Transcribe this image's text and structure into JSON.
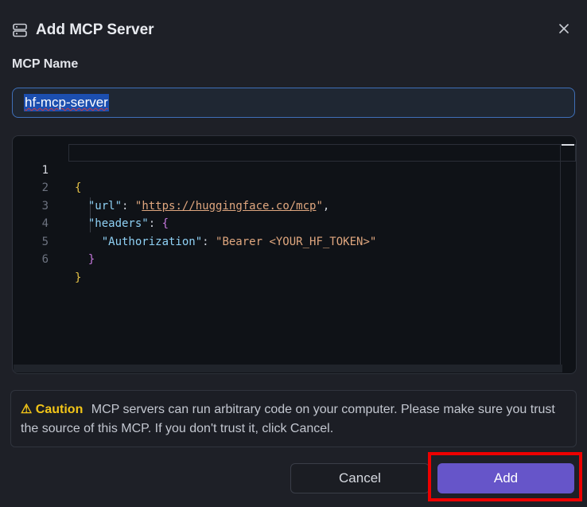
{
  "dialog": {
    "title": "Add MCP Server",
    "icon": "server-icon",
    "close_icon": "close-icon"
  },
  "name_field": {
    "label": "MCP Name",
    "value": "hf-mcp-server"
  },
  "editor": {
    "lines": [
      {
        "num": "1"
      },
      {
        "num": "2"
      },
      {
        "num": "3"
      },
      {
        "num": "4"
      },
      {
        "num": "5"
      },
      {
        "num": "6"
      }
    ],
    "tokens": {
      "open_brace": "{",
      "url_key": "\"url\"",
      "colon_space": ": ",
      "url_quote_open": "\"",
      "url_value": "https://huggingface.co/mcp",
      "url_quote_close": "\"",
      "comma": ",",
      "headers_key": "\"headers\"",
      "headers_open": "{",
      "auth_key": "\"Authorization\"",
      "auth_value": "\"Bearer <YOUR_HF_TOKEN>\"",
      "headers_close": "}",
      "close_brace": "}"
    }
  },
  "caution": {
    "title": "⚠ Caution",
    "text": "MCP servers can run arbitrary code on your computer. Please make sure you trust the source of this MCP. If you don't trust it, click Cancel."
  },
  "buttons": {
    "cancel": "Cancel",
    "add": "Add"
  },
  "colors": {
    "accent": "#6655c9",
    "caution": "#f2c518",
    "highlight": "#ee0000"
  }
}
